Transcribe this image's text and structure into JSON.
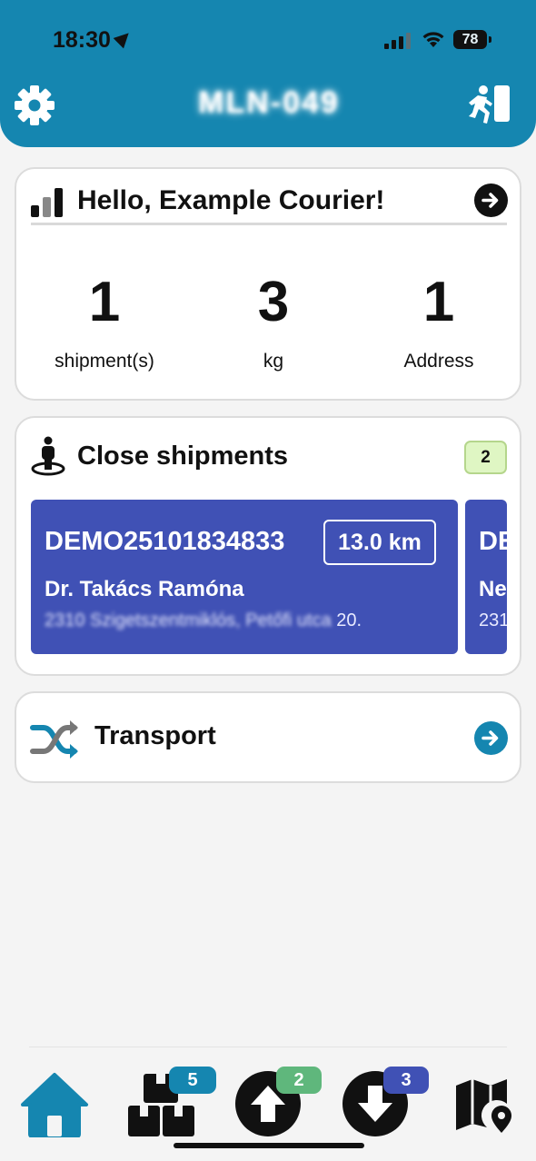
{
  "status_bar": {
    "time": "18:30",
    "battery": "78"
  },
  "header": {
    "title": "MLN-049",
    "settings_icon": "gear-icon",
    "exit_icon": "exit-running-icon",
    "bg_color": "#1586b0"
  },
  "summary": {
    "greeting": "Hello, Example Courier!",
    "stats": [
      {
        "value": "1",
        "label": "shipment(s)"
      },
      {
        "value": "3",
        "label": "kg"
      },
      {
        "value": "1",
        "label": "Address"
      }
    ]
  },
  "close_shipments": {
    "title": "Close shipments",
    "count": "2",
    "items": [
      {
        "id": "DEMO25101834833",
        "distance": "13.0 km",
        "name": "Dr. Takács Ramóna",
        "address_blurred": "2310 Szigetszentmiklós, Petőfi utca",
        "address_tail": "20."
      },
      {
        "id": "DE",
        "name": "Ne",
        "address_visible": "231"
      }
    ]
  },
  "transport": {
    "title": "Transport"
  },
  "tabbar": {
    "items": [
      {
        "icon": "home-icon",
        "active": true
      },
      {
        "icon": "boxes-icon",
        "badge": "5",
        "badge_color": "#1586b0"
      },
      {
        "icon": "upload-circle-icon",
        "badge": "2",
        "badge_color": "#5fb77c"
      },
      {
        "icon": "download-circle-icon",
        "badge": "3",
        "badge_color": "#4051b5"
      },
      {
        "icon": "map-pin-icon"
      }
    ]
  }
}
